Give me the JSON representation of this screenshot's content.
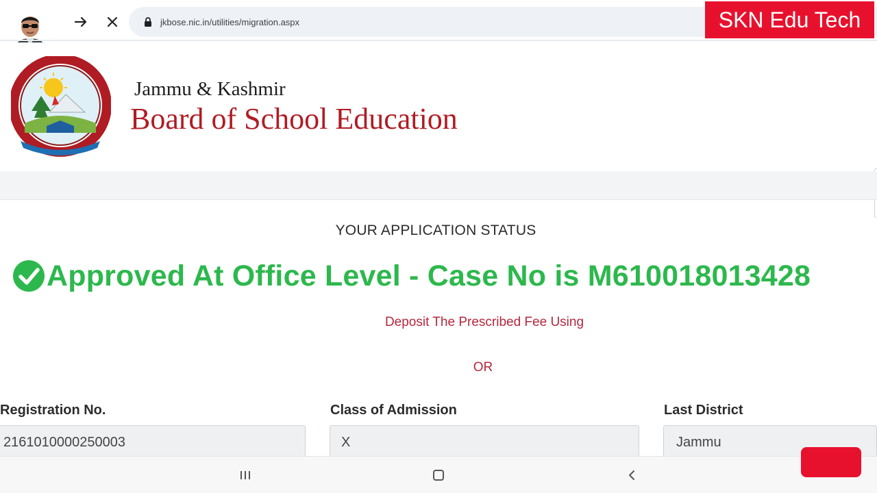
{
  "browser": {
    "url": "jkbose.nic.in/utilities/migration.aspx"
  },
  "badge": {
    "text": "SKN Edu Tech"
  },
  "site": {
    "title_line1": "Jammu & Kashmir",
    "title_line2": "Board of School Education"
  },
  "status": {
    "heading": "YOUR APPLICATION STATUS",
    "message": "Approved At Office Level - Case No is M610018013428",
    "deposit_note": "Deposit The Prescribed Fee Using",
    "or_label": "OR"
  },
  "fields": [
    {
      "label": "Registration No.",
      "value": "2161010000250003"
    },
    {
      "label": "Class of Admission",
      "value": "X"
    },
    {
      "label": "Last District",
      "value": "Jammu"
    }
  ],
  "colors": {
    "success": "#2db84d",
    "accent_red": "#b7263d",
    "brand_red": "#e8112d",
    "board_title": "#b01c24"
  },
  "icons": {
    "forward": "arrow-right-icon",
    "stop": "close-icon",
    "lock": "lock-icon",
    "status": "check-circle-icon",
    "recents": "recent-apps-icon",
    "home": "home-icon",
    "back": "back-icon"
  }
}
